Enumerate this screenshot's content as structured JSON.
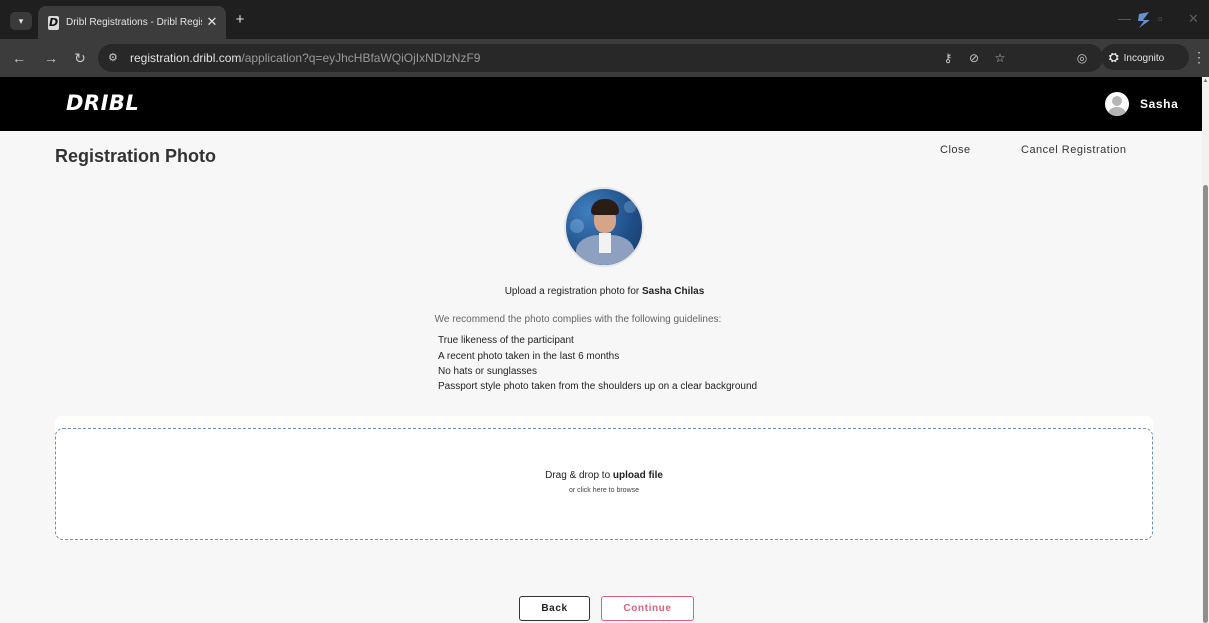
{
  "browser": {
    "tab_title": "Dribl Registrations - Dribl Regis",
    "new_tab_symbol": "+",
    "close_symbol": "✕",
    "url_host": "registration.dribl.com",
    "url_path": "/application?q=eyJhcHBfaWQiOjIxNDIzNzF9",
    "incognito_label": "Incognito"
  },
  "site": {
    "logo": "DRIBL",
    "user_name": "Sasha"
  },
  "page": {
    "title": "Registration Photo",
    "close_label": "Close",
    "cancel_label": "Cancel Registration",
    "upload_prefix": "Upload a registration photo for ",
    "participant_name": "Sasha Chilas",
    "guidelines_intro": "We recommend the photo complies with the following guidelines:",
    "guidelines": [
      "True likeness of the participant",
      "A recent photo taken in the last 6 months",
      "No hats or sunglasses",
      "Passport style photo taken from the shoulders up on a clear background"
    ]
  },
  "dropzone": {
    "main_prefix": "Drag & drop to ",
    "main_strong": "upload file",
    "sub": "or click here to browse"
  },
  "actions": {
    "back_label": "Back",
    "continue_label": "Continue"
  },
  "colors": {
    "accent": "#e0607f",
    "header_bg": "#000000",
    "dropzone_border": "#6a8fb8"
  }
}
